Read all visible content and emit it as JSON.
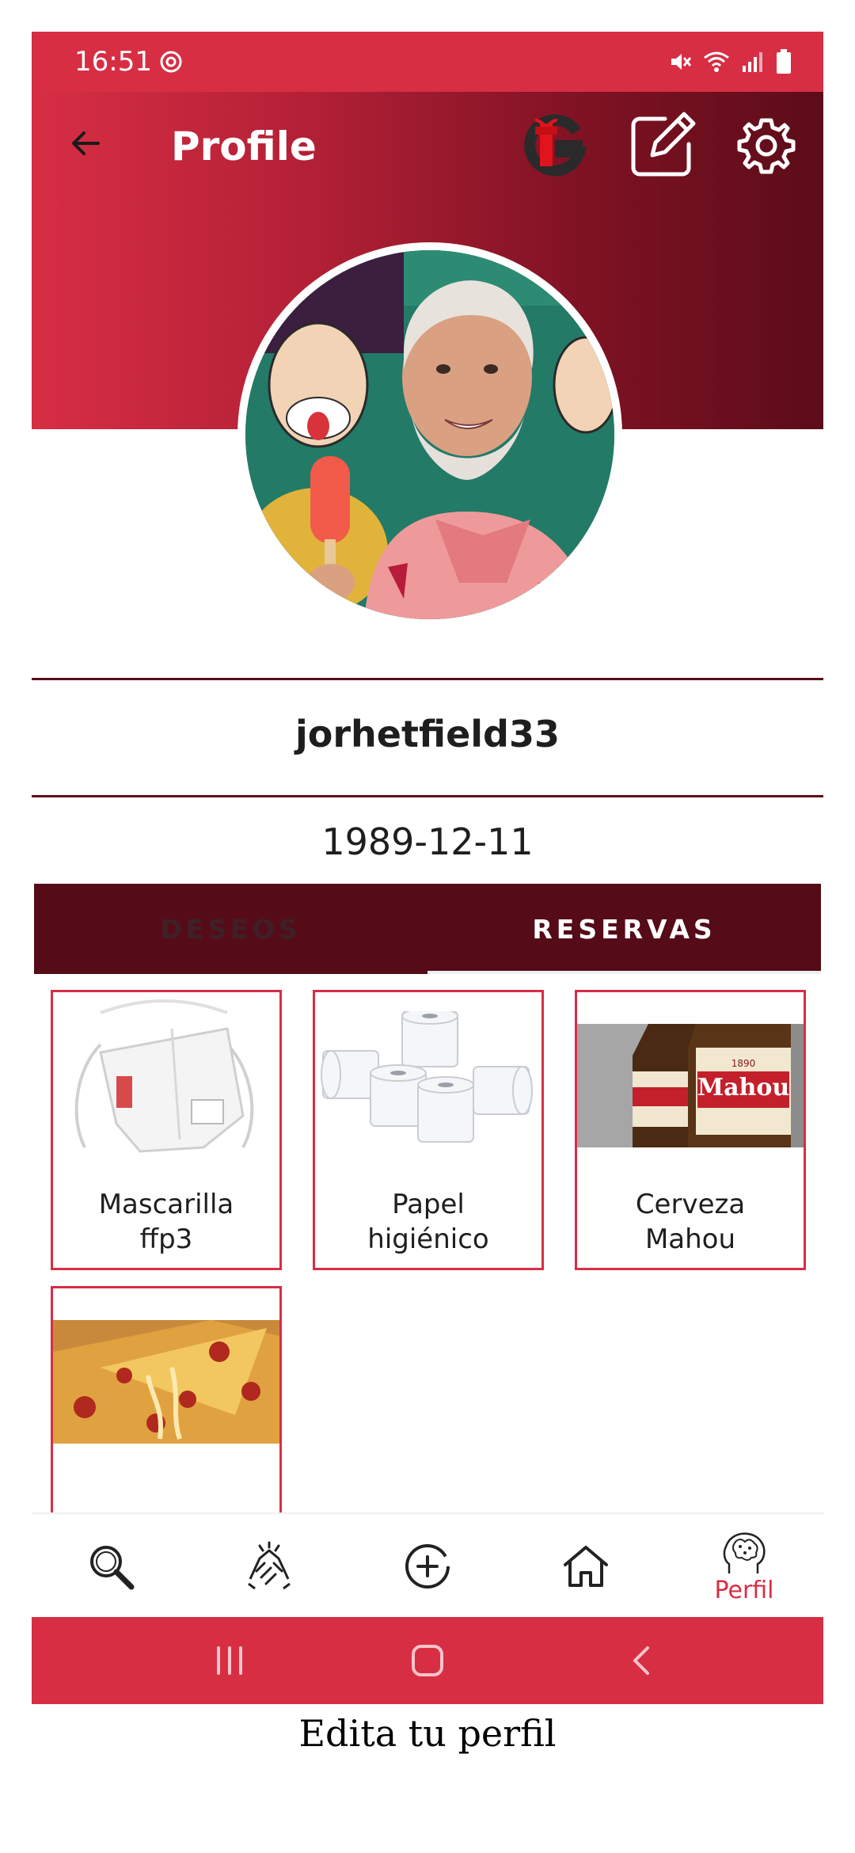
{
  "status_bar": {
    "time": "16:51",
    "icons": [
      "focus-icon",
      "mute-icon",
      "wifi-icon",
      "signal-icon",
      "battery-icon"
    ]
  },
  "header": {
    "title": "Profile",
    "back_icon": "arrow-left-icon",
    "logo_icon": "gift-logo-icon",
    "edit_icon": "edit-icon",
    "settings_icon": "gear-icon"
  },
  "profile": {
    "username": "jorhetfield33",
    "birthdate": "1989-12-11"
  },
  "tabs": [
    {
      "label": "DESEOS",
      "active": false
    },
    {
      "label": "RESERVAS",
      "active": true
    }
  ],
  "items": [
    {
      "name": "Mascarilla ffp3",
      "line1": "Mascarilla",
      "line2": "ffp3",
      "image": "face-mask"
    },
    {
      "name": "Papel higiénico",
      "line1": "Papel",
      "line2": "higiénico",
      "image": "toilet-paper"
    },
    {
      "name": "Cerveza Mahou",
      "line1": "Cerveza",
      "line2": "Mahou",
      "image": "beer-bottles"
    },
    {
      "name": "",
      "line1": "",
      "line2": "",
      "image": "pizza"
    }
  ],
  "bottom_nav": [
    {
      "icon": "search-icon",
      "label": ""
    },
    {
      "icon": "handshake-icon",
      "label": ""
    },
    {
      "icon": "add-circle-icon",
      "label": ""
    },
    {
      "icon": "home-icon",
      "label": ""
    },
    {
      "icon": "brain-profile-icon",
      "label": "Perfil",
      "active": true
    }
  ],
  "colors": {
    "primary": "#d72e44",
    "dark": "#550c18",
    "text": "#1e1e1e"
  },
  "caption": "Edita tu perfil"
}
